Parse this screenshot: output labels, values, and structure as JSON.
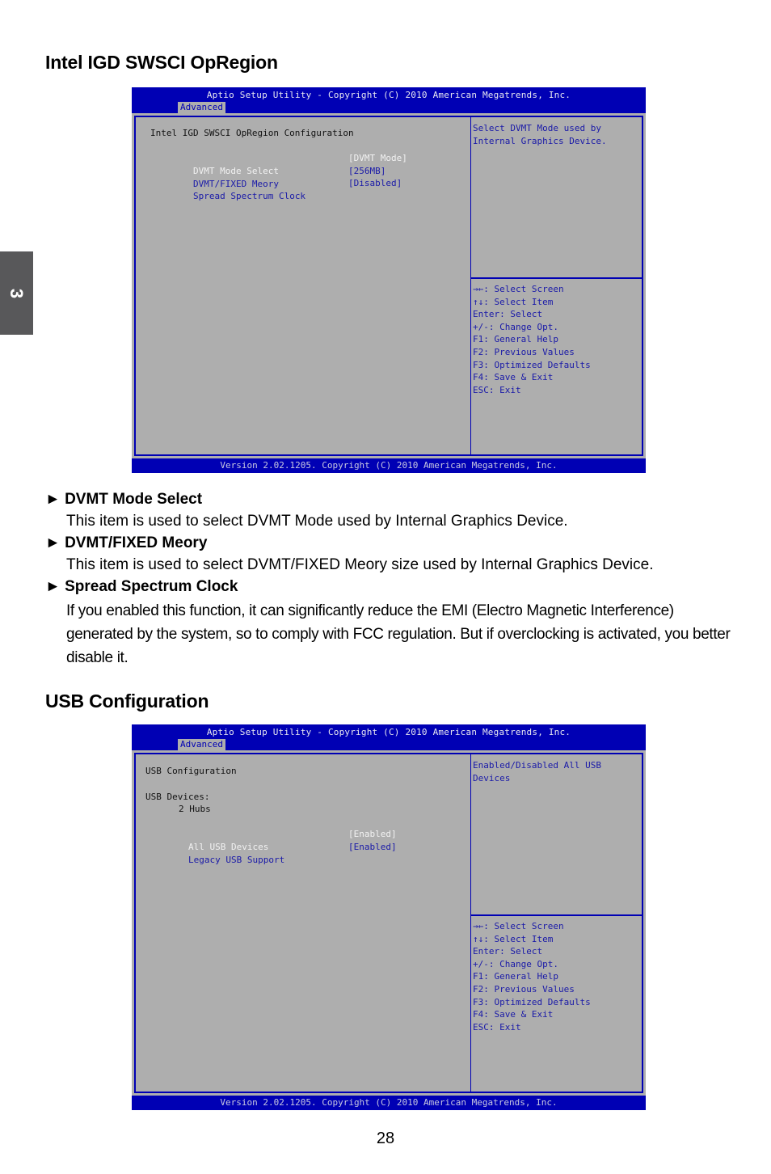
{
  "chapter_tab": "3",
  "page_number": "28",
  "sections": [
    {
      "title": "Intel IGD SWSCI OpRegion",
      "bios": {
        "header_title": "Aptio Setup Utility - Copyright (C) 2010 American Megatrends, Inc.",
        "active_tab": "Advanced",
        "panel_heading": "Intel IGD SWSCI OpRegion Configuration",
        "items": [
          {
            "label": "DVMT Mode Select",
            "value": "[DVMT Mode]",
            "selected": true
          },
          {
            "label": "DVMT/FIXED Meory",
            "value": "[256MB]",
            "selected": false
          },
          {
            "label": "Spread Spectrum Clock",
            "value": "[Disabled]",
            "selected": false
          }
        ],
        "help_text_1": "Select DVMT Mode used by",
        "help_text_2": "Internal Graphics Device.",
        "keys": [
          "→←: Select Screen",
          "↑↓: Select Item",
          "Enter: Select",
          "+/-: Change Opt.",
          "F1: General Help",
          "F2: Previous Values",
          "F3: Optimized Defaults",
          "F4: Save & Exit",
          "ESC: Exit"
        ],
        "footer": "Version 2.02.1205. Copyright (C) 2010 American Megatrends, Inc."
      },
      "descriptions": [
        {
          "heading": "► DVMT Mode Select",
          "text": "This item is used to select DVMT Mode used by Internal Graphics Device."
        },
        {
          "heading": "► DVMT/FIXED Meory",
          "text": "This item is used to select DVMT/FIXED Meory size used by Internal Graphics Device."
        },
        {
          "heading": "► Spread Spectrum Clock",
          "text": "If you enabled this function, it can significantly reduce the EMI (Electro Magnetic Interference) generated by the system, so to comply with FCC regulation. But if overclocking is activated, you better disable it."
        }
      ]
    },
    {
      "title": "USB Configuration",
      "bios": {
        "header_title": "Aptio Setup Utility - Copyright (C) 2010 American Megatrends, Inc.",
        "active_tab": "Advanced",
        "panel_heading": "USB Configuration",
        "devices_label": "USB Devices:",
        "devices_value": "2 Hubs",
        "items": [
          {
            "label": "All USB Devices",
            "value": "[Enabled]",
            "selected": true
          },
          {
            "label": "Legacy USB Support",
            "value": "[Enabled]",
            "selected": false
          }
        ],
        "help_text_1": "Enabled/Disabled All USB",
        "help_text_2": "Devices",
        "keys": [
          "→←: Select Screen",
          "↑↓: Select Item",
          "Enter: Select",
          "+/-: Change Opt.",
          "F1: General Help",
          "F2: Previous Values",
          "F3: Optimized Defaults",
          "F4: Save & Exit",
          "ESC: Exit"
        ],
        "footer": "Version 2.02.1205. Copyright (C) 2010 American Megatrends, Inc."
      }
    }
  ]
}
